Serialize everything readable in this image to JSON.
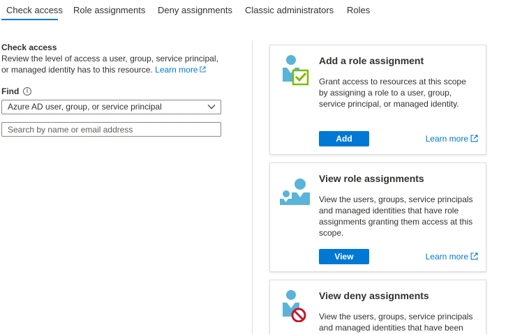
{
  "tabs": [
    {
      "label": "Check access",
      "active": true
    },
    {
      "label": "Role assignments"
    },
    {
      "label": "Deny assignments"
    },
    {
      "label": "Classic administrators"
    },
    {
      "label": "Roles"
    }
  ],
  "check_access": {
    "title": "Check access",
    "description": "Review the level of access a user, group, service principal, or managed identity has to this resource.",
    "learn_more": "Learn more",
    "find_label": "Find",
    "find_info_icon": "info-icon",
    "find_value": "Azure AD user, group, or service principal",
    "search_placeholder": "Search by name or email address"
  },
  "cards": {
    "add": {
      "title": "Add a role assignment",
      "description": "Grant access to resources at this scope by assigning a role to a user, group, service principal, or managed identity.",
      "button": "Add",
      "link": "Learn more",
      "icon": "user-check-icon"
    },
    "view": {
      "title": "View role assignments",
      "description": "View the users, groups, service principals and managed identities that have role assignments granting them access at this scope.",
      "button": "View",
      "link": "Learn more",
      "icon": "users-group-icon"
    },
    "deny": {
      "title": "View deny assignments",
      "description": "View the users, groups, service principals and managed identities that have been",
      "icon": "user-deny-icon"
    }
  },
  "colors": {
    "accent": "#0078d4",
    "icon_blue": "#59b4d9",
    "check_green": "#7fba00",
    "deny_red": "#c7152c"
  }
}
